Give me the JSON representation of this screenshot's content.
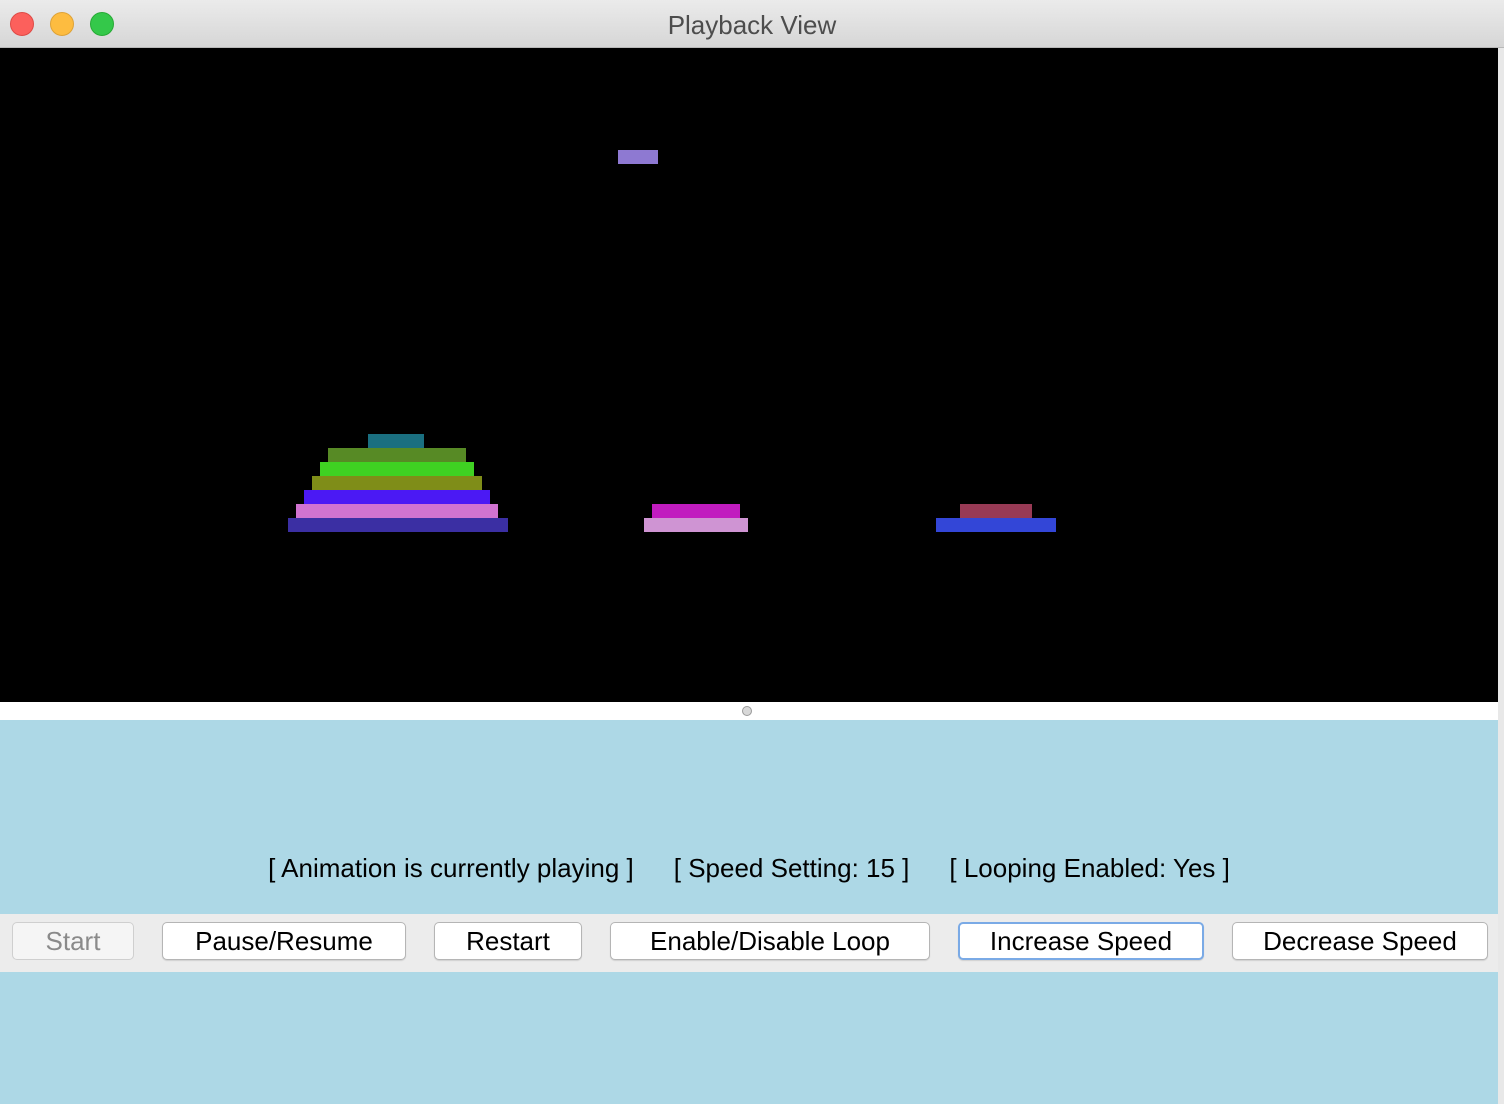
{
  "window": {
    "title": "Playback View",
    "controls": [
      "close",
      "minimize",
      "zoom"
    ]
  },
  "canvas": {
    "background": "#000000",
    "shapes": [
      {
        "name": "floating-disk",
        "color": "#8e79d2"
      },
      {
        "name": "pole-1-disk-1",
        "color": "#1a6f80"
      },
      {
        "name": "pole-1-disk-2",
        "color": "#578a25"
      },
      {
        "name": "pole-1-disk-3",
        "color": "#3fd122"
      },
      {
        "name": "pole-1-disk-4",
        "color": "#7f8d18"
      },
      {
        "name": "pole-1-disk-5",
        "color": "#4b19f4"
      },
      {
        "name": "pole-1-disk-6",
        "color": "#d173d0"
      },
      {
        "name": "pole-1-disk-7",
        "color": "#3b2fa3"
      },
      {
        "name": "pole-2-disk-1",
        "color": "#c11cbf"
      },
      {
        "name": "pole-2-disk-2",
        "color": "#cf94d3"
      },
      {
        "name": "pole-3-disk-1",
        "color": "#983a55"
      },
      {
        "name": "pole-3-disk-2",
        "color": "#3346d7"
      }
    ]
  },
  "status": {
    "playing": "[ Animation is currently playing ]",
    "speed": "[ Speed Setting: 15 ]",
    "looping": "[ Looping Enabled: Yes ]"
  },
  "controls": {
    "start": "Start",
    "pause_resume": "Pause/Resume",
    "restart": "Restart",
    "loop_toggle": "Enable/Disable Loop",
    "increase_speed": "Increase Speed",
    "decrease_speed": "Decrease Speed"
  },
  "colors": {
    "panel_background": "#add8e6",
    "button_strip": "#ececec",
    "focus_ring": "#7aaae6"
  }
}
